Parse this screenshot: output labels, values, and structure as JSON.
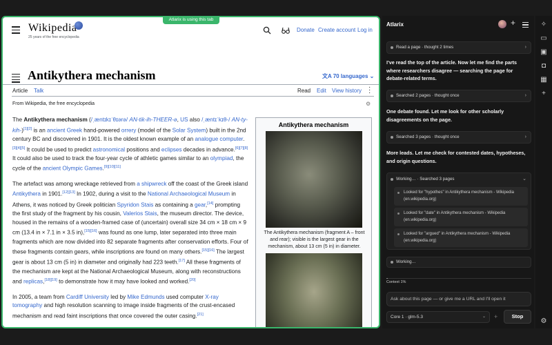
{
  "wiki": {
    "badge": "Atlarix is using this tab",
    "logo_word": "Wikipedia",
    "tagline": "25 years of the free encyclopedia",
    "top_links": [
      "Donate",
      "Create account",
      "Log in"
    ],
    "title": "Antikythera mechanism",
    "languages": "70 languages",
    "tabs_left": [
      "Article",
      "Talk"
    ],
    "tabs_right": [
      "Read",
      "Edit",
      "View history"
    ],
    "from": "From Wikipedia, the free encyclopedia",
    "infobox_title": "Antikythera mechanism",
    "infobox_caption": "The Antikythera mechanism (fragment A – front and rear); visible is the largest gear in the mechanism, about 13 cm (5 in) in diameter."
  },
  "side": {
    "title": "Atlarix",
    "step1": "Read a page · thought 2 times",
    "msg1": "I've read the top of the article. Now let me find the parts where researchers disagree — searching the page for debate-related terms.",
    "step2": "Searched 2 pages · thought once",
    "msg2": "One debate found. Let me look for other scholarly disagreements on the page.",
    "step3": "Searched 3 pages · thought once",
    "msg3": "More leads. Let me check for contested dates, hypotheses, and origin questions.",
    "working_head": "Working… · Searched 3 pages",
    "lookups": [
      "Looked for \"hypothes\" in Antikythera mechanism - Wikipedia (en.wikipedia.org)",
      "Looked for \"date\" in Antikythera mechanism - Wikipedia (en.wikipedia.org)",
      "Looked for \"argued\" in Antikythera mechanism - Wikipedia (en.wikipedia.org)"
    ],
    "working2": "Working…",
    "context_label": "Context 1%",
    "context_fraction": 0.01,
    "input_placeholder": "Ask about this page — or give me a URL and I'll open it",
    "model": "Core 1 · glm-5.3",
    "stop": "Stop"
  }
}
